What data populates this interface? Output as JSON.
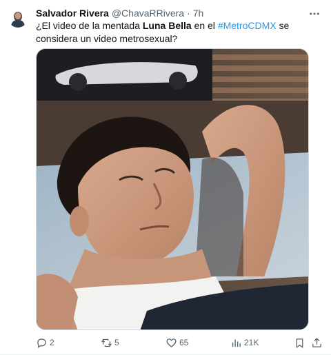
{
  "tweet": {
    "author_name": "Salvador Rivera",
    "handle": "@ChavaRRivera",
    "separator": "·",
    "time": "7h",
    "text_part1": "¿El video de la mentada ",
    "text_bold": "Luna Bella",
    "text_part2": " en el ",
    "hashtag": "#MetroCDMX",
    "text_part3": " se considera un video metrosexual?"
  },
  "actions": {
    "replies": "2",
    "reposts": "5",
    "likes": "65",
    "views": "21K"
  },
  "colors": {
    "accent": "#1d9bf0",
    "muted": "#536471",
    "text": "#0f1419"
  },
  "icons": {
    "more": "more-dots-icon",
    "reply": "reply-icon",
    "repost": "repost-icon",
    "like": "heart-icon",
    "views": "views-icon",
    "bookmark": "bookmark-icon",
    "share": "share-icon"
  }
}
